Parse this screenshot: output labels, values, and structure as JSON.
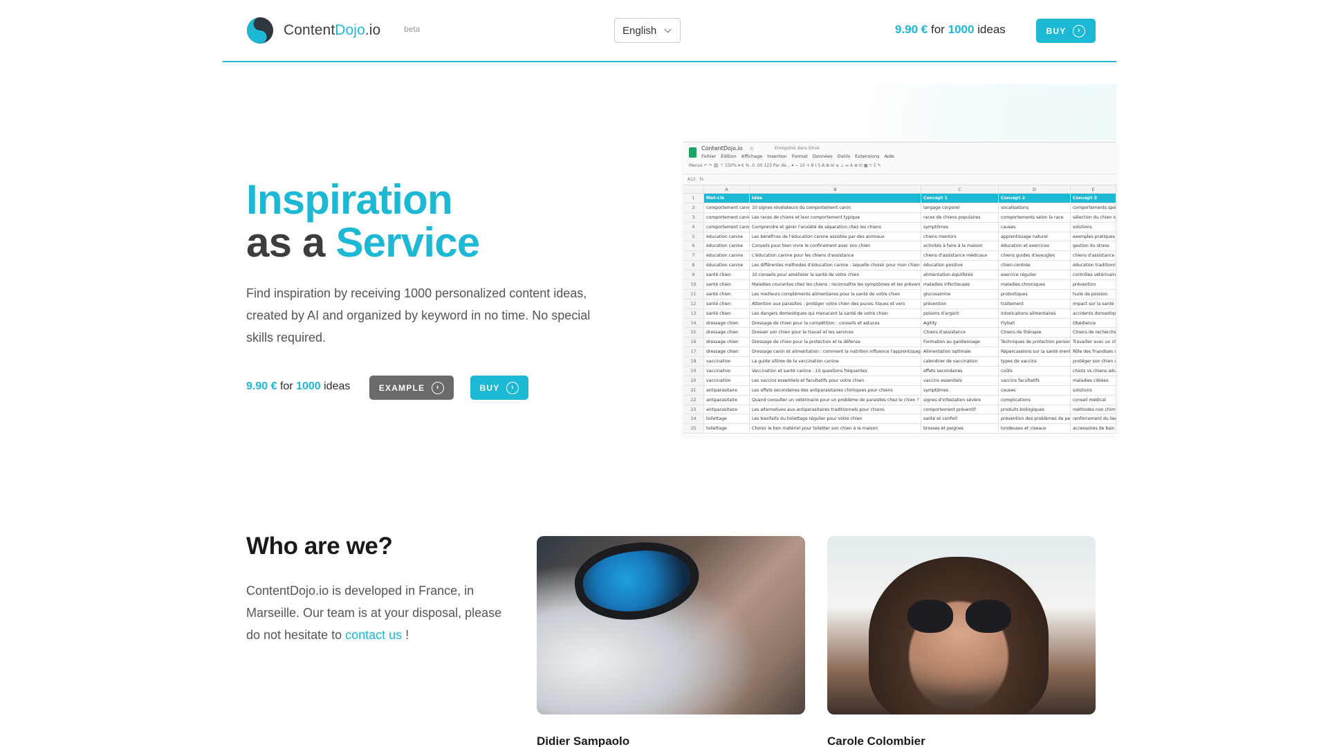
{
  "header": {
    "brand_prefix": "Content",
    "brand_accent": "Dojo",
    "brand_suffix": ".io",
    "beta": "beta",
    "language": "English",
    "price_amount": "9.90 €",
    "price_for": "for",
    "price_count": "1000",
    "price_unit": "ideas",
    "buy_label": "BUY"
  },
  "hero": {
    "title_line1": "Inspiration",
    "title_line2_prefix": "as a",
    "title_line2_accent": "Service",
    "lead": "Find inspiration by receiving 1000 personalized content ideas, created by AI and organized by keyword in no time. No special skills required.",
    "price_amount": "9.90 €",
    "price_for": "for",
    "price_count": "1000",
    "price_unit": "ideas",
    "example_label": "EXAMPLE",
    "buy_label": "BUY"
  },
  "spreadsheet": {
    "title": "ContentDojo.io",
    "saved_status": "Enregistré dans Drive",
    "menu": [
      "Fichier",
      "Édition",
      "Affichage",
      "Insertion",
      "Format",
      "Données",
      "Outils",
      "Extensions",
      "Aide"
    ],
    "toolbar": "Menus   ↶  ↷  🖨  ⊤   150%  ▾   €  %  .0  .00  123   Par dé...  ▾   −  10  +   B  I  S  A   ⊞  ⊟   ≡  ⊥  ↔  A   ⊕  ⊡  ▦  ▽  Σ   ✎",
    "cell_ref": "A12",
    "fx": "fx",
    "columns": [
      "A",
      "B",
      "C",
      "D",
      "E"
    ],
    "header_row": [
      "Mot-clé",
      "Idée",
      "Concept 1",
      "Concept 2",
      "Concept 3"
    ],
    "rows": [
      [
        "comportement canin",
        "10 signes révélateurs du comportement canin",
        "langage corporel",
        "vocalisations",
        "comportements spécif"
      ],
      [
        "comportement canin",
        "Les races de chiens et leur comportement typique",
        "races de chiens populaires",
        "comportements selon la race",
        "sélection du chien idé"
      ],
      [
        "comportement canin",
        "Comprendre et gérer l'anxiété de séparation chez les chiens",
        "symptômes",
        "causes",
        "solutions"
      ],
      [
        "éducation canine",
        "Les bénéfices de l'éducation canine assistée par des animaux",
        "chiens mentors",
        "apprentissage naturel",
        "exemples pratiques"
      ],
      [
        "éducation canine",
        "Conseils pour bien vivre le confinement avec son chien",
        "activités à faire à la maison",
        "éducation et exercices",
        "gestion du stress"
      ],
      [
        "éducation canine",
        "L'éducation canine pour les chiens d'assistance",
        "chiens d'assistance médicaux",
        "chiens guides d'aveugles",
        "chiens d'assistance psy"
      ],
      [
        "éducation canine",
        "Les différentes méthodes d'éducation canine : laquelle choisir pour mon chien ?",
        "éducation positive",
        "chien-centrée",
        "éducation traditionnel"
      ],
      [
        "santé chien",
        "10 conseils pour améliorer la santé de votre chien",
        "alimentation équilibrée",
        "exercice régulier",
        "contrôles vétérinaires"
      ],
      [
        "santé chien",
        "Maladies courantes chez les chiens : reconnaître les symptômes et les prévenir",
        "maladies infectieuses",
        "maladies chroniques",
        "prévention"
      ],
      [
        "santé chien",
        "Les meilleurs compléments alimentaires pour la santé de votre chien",
        "glucosamine",
        "probiotiques",
        "huile de poisson"
      ],
      [
        "santé chien",
        "Attention aux parasites : protéger votre chien des puces, tiques et vers",
        "prévention",
        "traitement",
        "impact sur la santé"
      ],
      [
        "santé chien",
        "Les dangers domestiques qui menacent la santé de votre chien",
        "poisons d'argent",
        "intoxications alimentaires",
        "accidents domestiques"
      ],
      [
        "dressage chien",
        "Dressage de chien pour la compétition : conseils et astuces",
        "Agility",
        "Flyball",
        "Obédience"
      ],
      [
        "dressage chien",
        "Dresser son chien pour le travail et les services",
        "Chiens d'assistance",
        "Chiens de thérapie",
        "Chiens de recherche et"
      ],
      [
        "dressage chien",
        "Dressage de chien pour la protection et la défense",
        "Formation au gardiennage",
        "Techniques de protection personne",
        "Travailler avec un chien"
      ],
      [
        "dressage chien",
        "Dressage canin et alimentation : comment la nutrition influence l'apprentissage",
        "Alimentation optimale",
        "Répercussions sur la santé mentale",
        "Rôle des friandises dan"
      ],
      [
        "vaccination",
        "La guide ultime de la vaccination canine",
        "calendrier de vaccination",
        "types de vaccins",
        "protéger son chien car"
      ],
      [
        "vaccination",
        "Vaccination et santé canine : 10 questions fréquentes",
        "effets secondaires",
        "coûts",
        "chiots vs chiens adulte"
      ],
      [
        "vaccination",
        "Les vaccins essentiels et facultatifs pour votre chien",
        "vaccins essentiels",
        "vaccins facultatifs",
        "maladies ciblées"
      ],
      [
        "antiparasitaire",
        "Les effets secondaires des antiparasitaires chimiques pour chiens",
        "symptômes",
        "causes",
        "solutions"
      ],
      [
        "antiparasitaire",
        "Quand consulter un vétérinaire pour un problème de parasites chez le chien ?",
        "signes d'infestation sévère",
        "complications",
        "conseil médical"
      ],
      [
        "antiparasitaire",
        "Les alternatives aux antiparasitaires traditionnels pour chiens",
        "comportement préventif",
        "produits biologiques",
        "méthodes non chimiqu"
      ],
      [
        "toilettage",
        "Les bienfaits du toilettage régulier pour votre chien",
        "santé et confort",
        "prévention des problèmes de peau",
        "renforcement du lien a"
      ],
      [
        "toilettage",
        "Choisir le bon matériel pour toiletter son chien à la maison",
        "brosses et peignes",
        "tondeuses et ciseaux",
        "accessoires de bain"
      ]
    ]
  },
  "team": {
    "title": "Who are we?",
    "text_before_link": "ContentDojo.io is developed in France, in Marseille. Our team is at your disposal, please do not hesitate to ",
    "link": "contact us",
    "text_after_link": " !",
    "members": [
      {
        "name": "Didier Sampaolo"
      },
      {
        "name": "Carole Colombier"
      }
    ]
  },
  "colors": {
    "accent": "#1cb8d4",
    "dark_button": "#6a6a6a",
    "text": "#3d3d3d"
  },
  "icons": {
    "logo": "yin-yang-icon",
    "arrow": "arrow-right-circle-icon",
    "dropdown": "chevron-down-icon"
  }
}
